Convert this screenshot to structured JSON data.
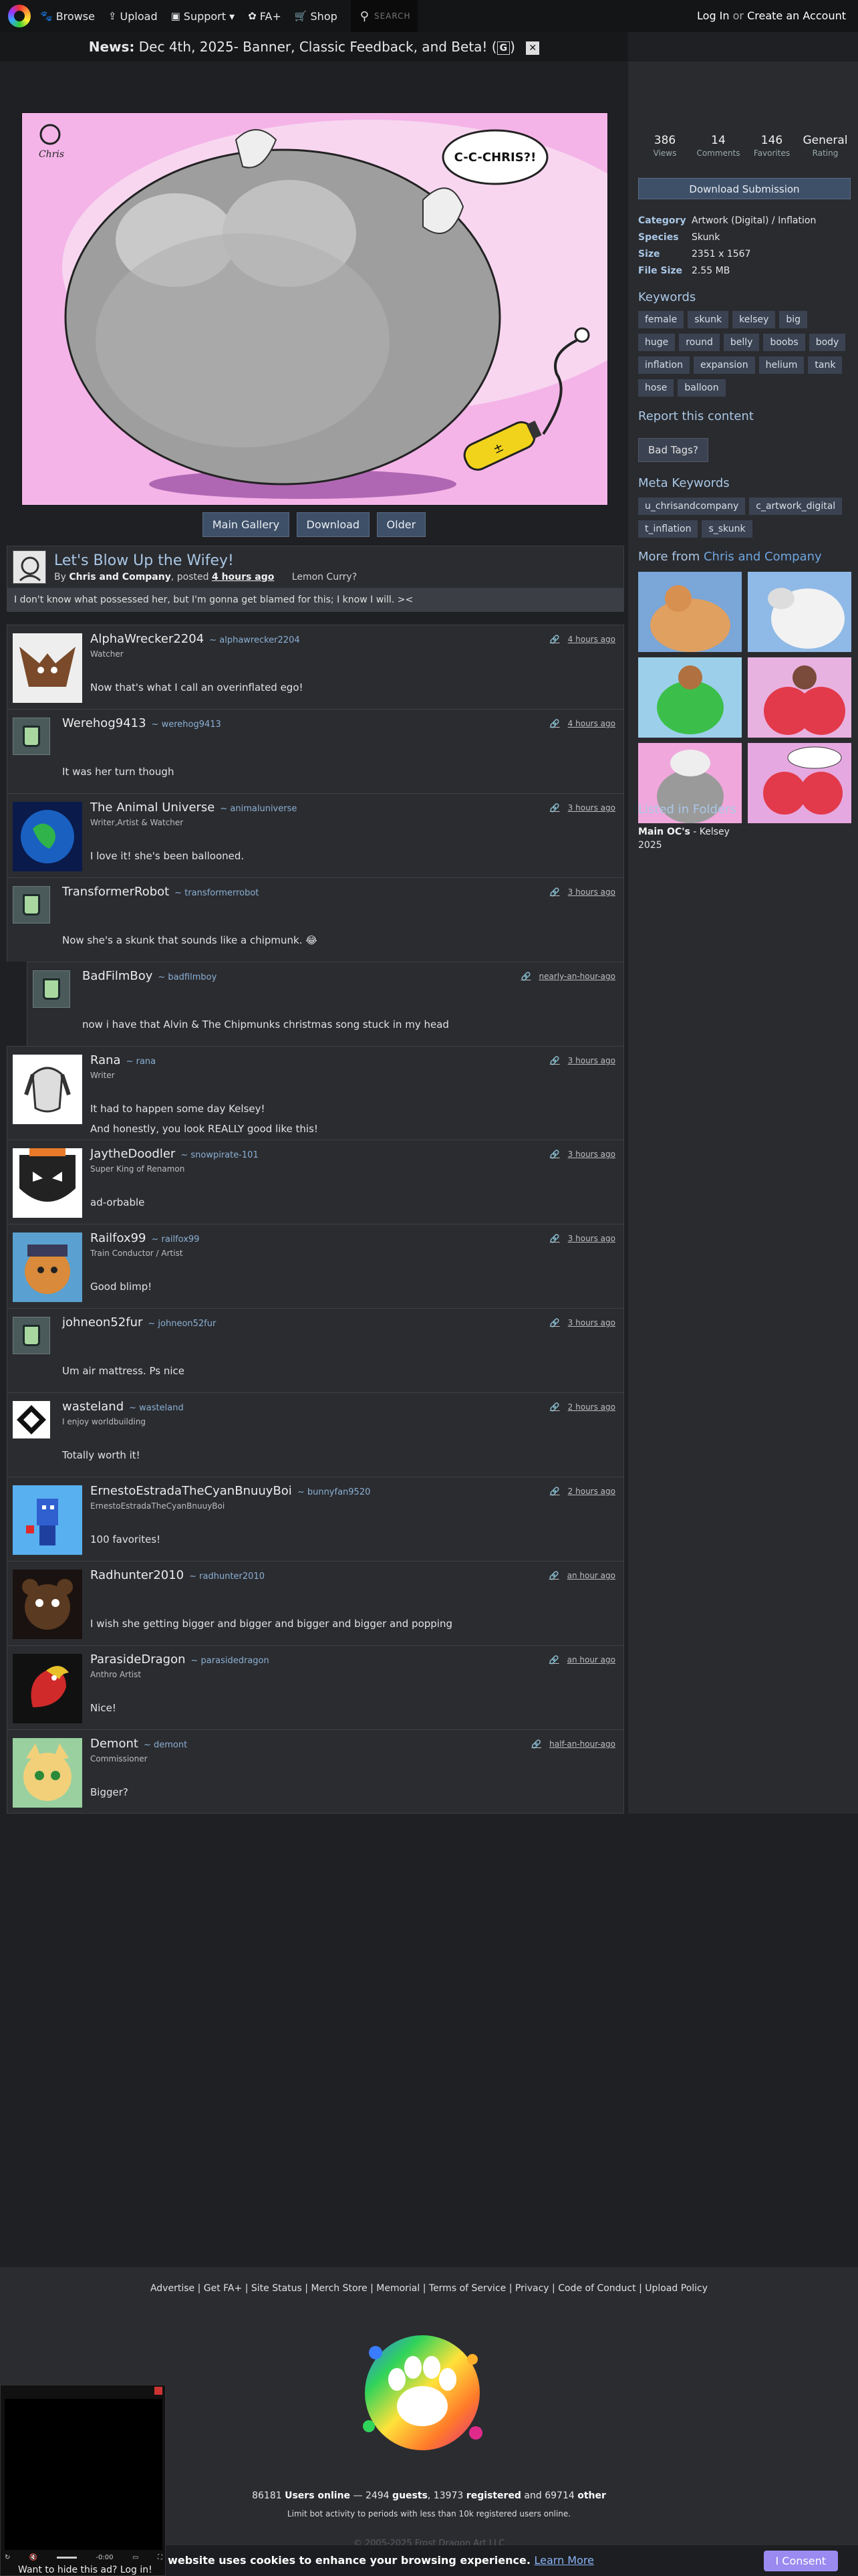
{
  "nav": {
    "items": [
      {
        "icon": "paw-icon",
        "label": "Browse"
      },
      {
        "icon": "upload-icon",
        "label": "Upload"
      },
      {
        "icon": "support-icon",
        "label": "Support ▾"
      },
      {
        "icon": "fa-plus-icon",
        "label": "FA+"
      },
      {
        "icon": "shop-icon",
        "label": "Shop"
      }
    ],
    "search_placeholder": "SEARCH",
    "login": "Log In",
    "or": "or",
    "create": "Create an Account"
  },
  "news": {
    "label": "News:",
    "text": "Dec 4th, 2025- Banner, Classic Feedback, and Beta!",
    "badge": "G"
  },
  "artwork": {
    "bubble": "C-C-CHRIS?!",
    "tank_label": "±"
  },
  "buttons": {
    "gallery": "Main Gallery",
    "download": "Download",
    "older": "Older"
  },
  "submission": {
    "title": "Let's Blow Up the Wifey!",
    "by": "By",
    "author": "Chris and Company",
    "posted": "posted",
    "time": "4 hours ago",
    "tag": "Lemon Curry?",
    "description": "I don't know what possessed her, but I'm gonna get blamed for this; I know I will. ><"
  },
  "comments": [
    {
      "name": "AlphaWrecker2204",
      "handle": "~ alphawrecker2204",
      "role": "Watcher",
      "time": "4 hours ago",
      "body": "Now that's what I call an overinflated ego!",
      "avatar": "bat"
    },
    {
      "name": "Werehog9413",
      "handle": "~ werehog9413",
      "role": "",
      "time": "4 hours ago",
      "body": "It was her turn though",
      "avatar": "bucket"
    },
    {
      "name": "The Animal Universe",
      "handle": "~ animaluniverse",
      "role": "Writer,Artist & Watcher",
      "time": "3 hours ago",
      "body": "I love it! she's been ballooned.",
      "avatar": "globe"
    },
    {
      "name": "TransformerRobot",
      "handle": "~ transformerrobot",
      "role": "",
      "time": "3 hours ago",
      "body": "Now she's a skunk that sounds like a chipmunk. 😂",
      "avatar": "bucket"
    },
    {
      "name": "BadFilmBoy",
      "handle": "~ badfilmboy",
      "role": "",
      "time": "nearly-an-hour-ago",
      "body": "now i have that Alvin & The Chipmunks christmas song stuck in my head",
      "avatar": "bucket",
      "reply": true
    },
    {
      "name": "Rana",
      "handle": "~ rana",
      "role": "Writer",
      "time": "3 hours ago",
      "body": "It had to happen some day Kelsey!",
      "body2": "And honestly, you look REALLY good like this!",
      "avatar": "dog"
    },
    {
      "name": "JaytheDoodler",
      "handle": "~ snowpirate-101",
      "role": "Super King of Renamon",
      "time": "3 hours ago",
      "body": "ad-orbable",
      "avatar": "mask"
    },
    {
      "name": "Railfox99",
      "handle": "~ railfox99",
      "role": "Train Conductor / Artist",
      "time": "3 hours ago",
      "body": "Good blimp!",
      "avatar": "fox"
    },
    {
      "name": "johneon52fur",
      "handle": "~ johneon52fur",
      "role": "",
      "time": "3 hours ago",
      "body": "Um air mattress. Ps nice",
      "avatar": "bucket"
    },
    {
      "name": "wasteland",
      "handle": "~ wasteland",
      "role": "I enjoy worldbuilding",
      "time": "2 hours ago",
      "body": "Totally worth it!",
      "avatar": "diamond"
    },
    {
      "name": "ErnestoEstradaTheCyanBnuuyBoi",
      "handle": "~ bunnyfan9520",
      "role": "ErnestoEstradaTheCyanBnuuyBoi",
      "time": "2 hours ago",
      "body": "100 favorites!",
      "avatar": "pixel"
    },
    {
      "name": "Radhunter2010",
      "handle": "~ radhunter2010",
      "role": "",
      "time": "an hour ago",
      "body": "I wish she getting bigger and bigger and bigger and bigger and popping",
      "avatar": "bear"
    },
    {
      "name": "ParasideDragon",
      "handle": "~ parasidedragon",
      "role": "Anthro Artist",
      "time": "an hour ago",
      "body": "Nice!",
      "avatar": "parrot"
    },
    {
      "name": "Demont",
      "handle": "~ demont",
      "role": "Commissioner",
      "time": "half-an-hour-ago",
      "body": "Bigger?",
      "avatar": "cat"
    }
  ],
  "stats": [
    {
      "n": "386",
      "l": "Views"
    },
    {
      "n": "14",
      "l": "Comments"
    },
    {
      "n": "146",
      "l": "Favorites"
    },
    {
      "n": "General",
      "l": "Rating"
    }
  ],
  "sidebar": {
    "download": "Download Submission",
    "info": [
      {
        "k": "Category",
        "v": "Artwork (Digital) / Inflation"
      },
      {
        "k": "Species",
        "v": "Skunk"
      },
      {
        "k": "Size",
        "v": "2351 x 1567"
      },
      {
        "k": "File Size",
        "v": "2.55 MB"
      }
    ],
    "keywords_title": "Keywords",
    "keywords": [
      "female",
      "skunk",
      "kelsey",
      "big",
      "huge",
      "round",
      "belly",
      "boobs",
      "body",
      "inflation",
      "expansion",
      "helium",
      "tank",
      "hose",
      "balloon"
    ],
    "report_title": "Report this content",
    "bad_tags": "Bad Tags?",
    "meta_title": "Meta Keywords",
    "meta": [
      "u_chrisandcompany",
      "c_artwork_digital",
      "t_inflation",
      "s_skunk"
    ],
    "more_from": "More from",
    "more_author": "Chris and Company",
    "folders_title": "Listed in Folders",
    "folder_name": "Main OC's",
    "folder_rest": " - Kelsey",
    "folder_year": "2025"
  },
  "footer": {
    "links": [
      "Advertise",
      "Get FA+",
      "Site Status",
      "Merch Store",
      "Memorial",
      "Terms of Service",
      "Privacy",
      "Code of Conduct",
      "Upload Policy"
    ],
    "users_online": "86181",
    "users_label": "Users online",
    "guests": "2494",
    "guests_label": "guests",
    "registered": "13973",
    "registered_label": "registered",
    "other": "69714",
    "other_label": "other",
    "limit": "Limit bot activity to periods with less than 10k registered users online.",
    "copyright": "© 2005-2025 Frost Dragon Art LLC"
  },
  "cookie": {
    "text": "s website uses cookies to enhance your browsing experience.",
    "learn": "Learn More",
    "consent": "I Consent"
  },
  "ad": {
    "hide": "Want to hide this ad? Log in!",
    "time": "-0:00"
  }
}
